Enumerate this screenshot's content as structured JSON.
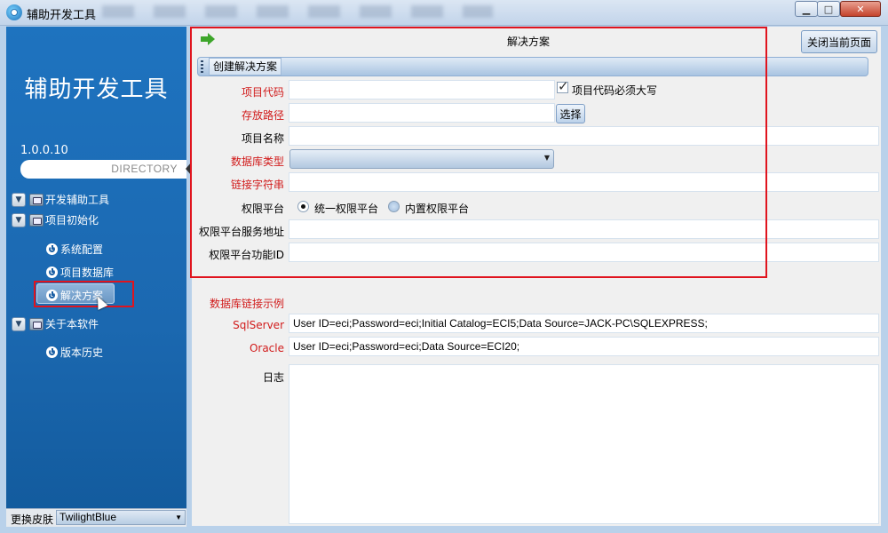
{
  "window": {
    "title": "辅助开发工具",
    "minimize_label": "▁",
    "maximize_label": "□",
    "close_label": "✕"
  },
  "sidebar": {
    "title": "辅助开发工具",
    "version": "1.0.0.10",
    "directory_label": "DIRECTORY",
    "tree": [
      {
        "label": "开发辅助工具",
        "expander": "▼"
      },
      {
        "label": "项目初始化",
        "expander": "▼"
      },
      {
        "label": "系统配置"
      },
      {
        "label": "项目数据库"
      },
      {
        "label": "解决方案"
      },
      {
        "label": "关于本软件",
        "expander": "▼"
      },
      {
        "label": "版本历史"
      }
    ],
    "skin_label": "更换皮肤",
    "skin_value": "TwilightBlue"
  },
  "main": {
    "page_title": "解决方案",
    "close_page_button": "关闭当前页面",
    "toolbar_button": "创建解决方案",
    "form": {
      "project_code_label": "项目代码",
      "project_code_value": "",
      "uppercase_checkbox_label": "项目代码必须大写",
      "storage_path_label": "存放路径",
      "storage_path_value": "",
      "choose_button": "选择",
      "project_name_label": "项目名称",
      "project_name_value": "",
      "db_type_label": "数据库类型",
      "db_type_value": "",
      "conn_string_label": "链接字符串",
      "conn_string_value": "",
      "auth_platform_label": "权限平台",
      "radio_unified": "统一权限平台",
      "radio_builtin": "内置权限平台",
      "auth_service_label": "权限平台服务地址",
      "auth_service_value": "",
      "auth_func_label": "权限平台功能ID",
      "auth_func_value": ""
    },
    "examples": {
      "heading": "数据库链接示例",
      "sqlserver_label": "SqlServer",
      "sqlserver_value": "User ID=eci;Password=eci;Initial Catalog=ECI5;Data Source=JACK-PC\\SQLEXPRESS;",
      "oracle_label": "Oracle",
      "oracle_value": "User ID=eci;Password=eci;Data Source=ECI20;"
    },
    "log_label": "日志",
    "log_value": ""
  },
  "colors": {
    "sidebar_bg": "#1b68b0",
    "required_label": "#d11b1b",
    "highlight_border": "#e0141e",
    "arrow_green": "#3da52a"
  }
}
